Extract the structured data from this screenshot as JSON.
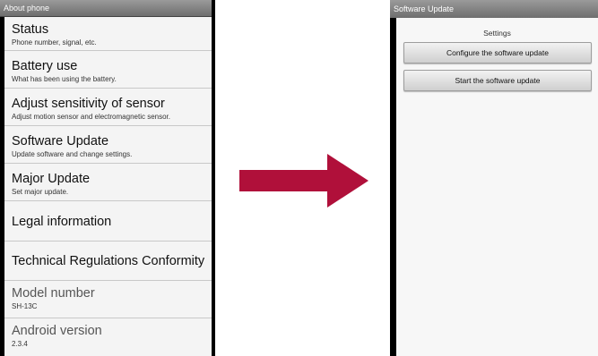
{
  "left_screen": {
    "title": "About phone",
    "items": [
      {
        "title": "Status",
        "summary": "Phone number, signal, etc."
      },
      {
        "title": "Battery use",
        "summary": "What has been using the battery."
      },
      {
        "title": "Adjust sensitivity of sensor",
        "summary": "Adjust motion sensor and electromagnetic sensor."
      },
      {
        "title": "Software Update",
        "summary": "Update software and change settings."
      },
      {
        "title": "Major Update",
        "summary": "Set major update."
      },
      {
        "title": "Legal information"
      },
      {
        "title": "Technical Regulations Conformity"
      },
      {
        "title": "Model number",
        "summary": "SH-13C"
      },
      {
        "title": "Android version",
        "summary": "2.3.4"
      }
    ]
  },
  "arrow_color": "#b0103a",
  "right_screen": {
    "title": "Software Update",
    "section_label": "Settings",
    "buttons": [
      {
        "label": "Configure the software update"
      },
      {
        "label": "Start the software update"
      }
    ]
  }
}
